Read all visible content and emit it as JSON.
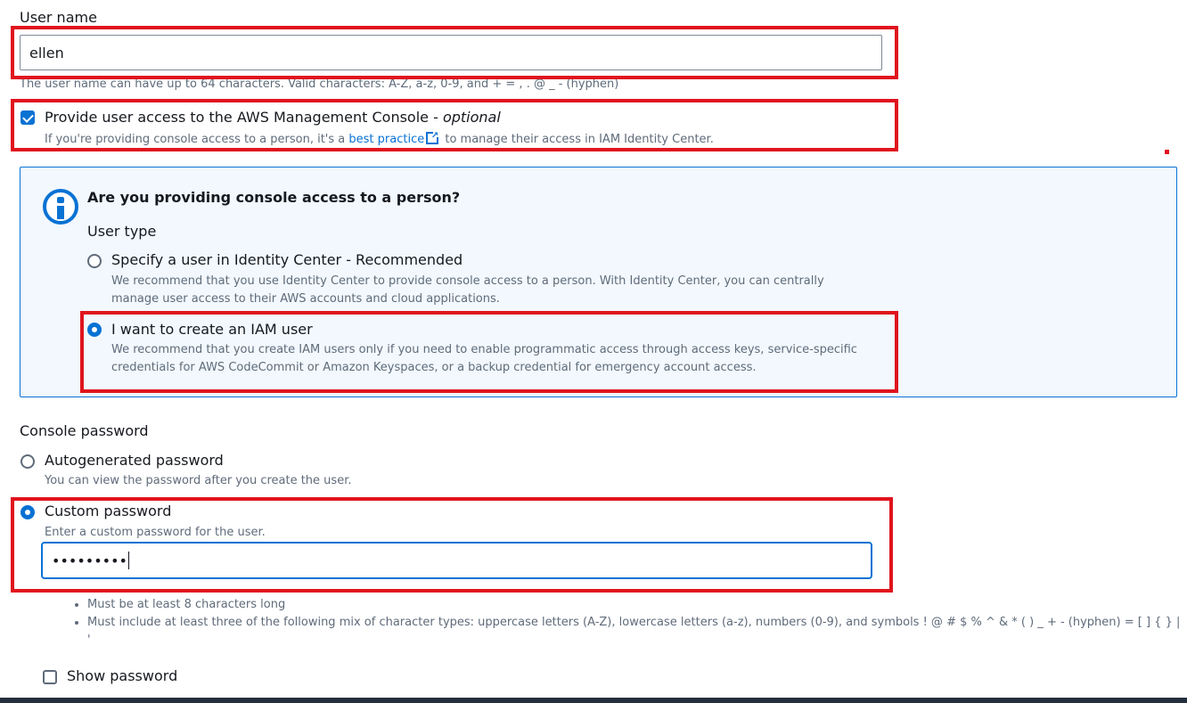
{
  "user_name": {
    "label": "User name",
    "value": "ellen",
    "help": "The user name can have up to 64 characters. Valid characters: A-Z, a-z, 0-9, and + = , . @ _ - (hyphen)"
  },
  "console_access": {
    "label": "Provide user access to the AWS Management Console - ",
    "label_optional": "optional",
    "checked": true,
    "help_before": "If you're providing console access to a person, it's a ",
    "help_link": "best practice",
    "help_after": " to manage their access in IAM Identity Center."
  },
  "info_box": {
    "icon": "info-icon",
    "title": "Are you providing console access to a person?",
    "user_type_label": "User type",
    "options": [
      {
        "label": "Specify a user in Identity Center - Recommended",
        "desc_line1": "We recommend that you use Identity Center to provide console access to a person. With Identity Center, you can centrally",
        "desc_line2": "manage user access to their AWS accounts and cloud applications.",
        "selected": false
      },
      {
        "label": "I want to create an IAM user",
        "desc_line1": "We recommend that you create IAM users only if you need to enable programmatic access through access keys, service-specific",
        "desc_line2": "credentials for AWS CodeCommit or Amazon Keyspaces, or a backup credential for emergency account access.",
        "selected": true
      }
    ]
  },
  "console_password": {
    "label": "Console password",
    "options": [
      {
        "label": "Autogenerated password",
        "desc": "You can view the password after you create the user.",
        "selected": false
      },
      {
        "label": "Custom password",
        "desc": "Enter a custom password for the user.",
        "selected": true
      }
    ],
    "password_value": "•••••••••",
    "rules": [
      "Must be at least 8 characters long",
      "Must include at least three of the following mix of character types: uppercase letters (A-Z), lowercase letters (a-z), numbers (0-9), and symbols ! @ # $ % ^ & * ( ) _ + - (hyphen) = [ ] { } | '"
    ],
    "show_password_label": "Show password",
    "show_password_checked": false
  },
  "colors": {
    "accent": "#0972d3",
    "highlight": "#e0141e",
    "info_bg": "#f2f8fd"
  }
}
